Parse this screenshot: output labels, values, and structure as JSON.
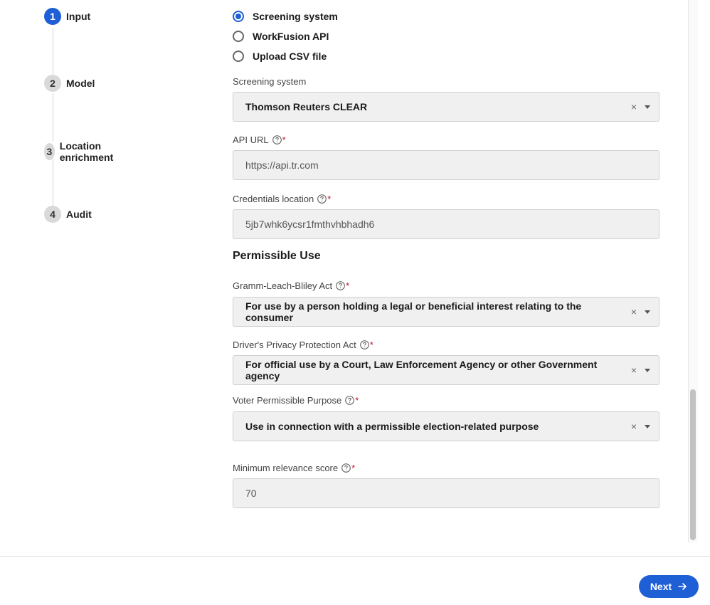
{
  "stepper": {
    "steps": [
      {
        "num": "1",
        "label": "Input"
      },
      {
        "num": "2",
        "label": "Model"
      },
      {
        "num": "3",
        "label": "Location enrichment"
      },
      {
        "num": "4",
        "label": "Audit"
      }
    ]
  },
  "input_source": {
    "options": [
      "Screening system",
      "WorkFusion API",
      "Upload CSV file"
    ],
    "selected": "Screening system"
  },
  "screening_system": {
    "label": "Screening system",
    "value": "Thomson Reuters CLEAR"
  },
  "api_url": {
    "label": "API URL",
    "value": "https://api.tr.com"
  },
  "credentials": {
    "label": "Credentials location",
    "value": "5jb7whk6ycsr1fmthvhbhadh6"
  },
  "permissible_use": {
    "title": "Permissible Use",
    "glba": {
      "label": "Gramm-Leach-Bliley Act",
      "value": "For use by a person holding a legal or beneficial interest relating to the consumer"
    },
    "dppa": {
      "label": "Driver's Privacy Protection Act",
      "value": "For official use by a Court, Law Enforcement Agency or other Government agency"
    },
    "voter": {
      "label": "Voter Permissible Purpose",
      "value": "Use in connection with a permissible election-related purpose"
    }
  },
  "min_relevance": {
    "label": "Minimum relevance score",
    "value": "70"
  },
  "required_mark": "*",
  "clear_glyph": "×",
  "footer": {
    "next_label": "Next"
  },
  "colors": {
    "accent": "#1f5fd6",
    "required": "#c4122f",
    "field_bg": "#f0f0f0"
  }
}
